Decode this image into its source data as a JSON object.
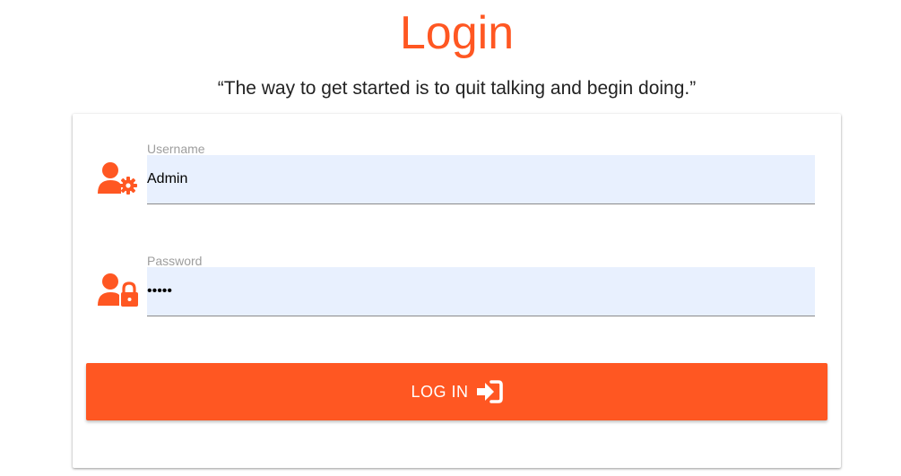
{
  "page": {
    "title": "Login",
    "quote": "“The way to get started is to quit talking and begin doing.”"
  },
  "form": {
    "username": {
      "label": "Username",
      "value": "Admin",
      "icon": "user-gear-icon"
    },
    "password": {
      "label": "Password",
      "value": "admin",
      "icon": "user-lock-icon"
    },
    "submit": {
      "label": "LOG IN",
      "icon": "sign-in-icon"
    }
  },
  "colors": {
    "accent": "#ff5722",
    "input_background": "#e8f0fe",
    "label": "#9e9e9e"
  }
}
